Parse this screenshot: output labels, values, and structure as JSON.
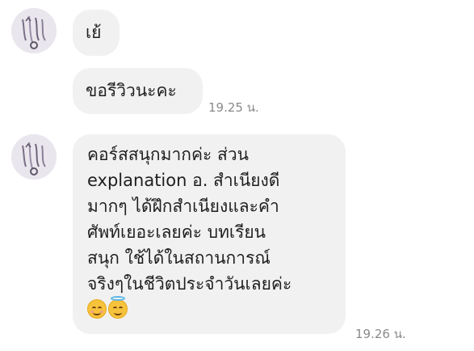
{
  "messages": [
    {
      "text": "เย้"
    },
    {
      "text": "ขอรีวิวนะคะ",
      "time": "19.25 น."
    },
    {
      "lines": [
        "คอร์สสนุกมากค่ะ ส่วน",
        "explanation อ. สำเนียงดี",
        "มากๆ ได้ฝึกสำเนียงและคำ",
        "ศัพท์เยอะเลยค่ะ บทเรียน",
        "สนุก ใช้ได้ในสถานการณ์",
        "จริงๆในชีวิตประจำวันเลยค่ะ"
      ],
      "emojis": [
        "smiling-face-icon",
        "smiling-face-with-halo-icon"
      ],
      "time": "19.26 น."
    }
  ],
  "colors": {
    "bubble": "#f1f1f1",
    "timestamp": "#8a8a8a",
    "avatar_bg": "#e7e3ec"
  }
}
